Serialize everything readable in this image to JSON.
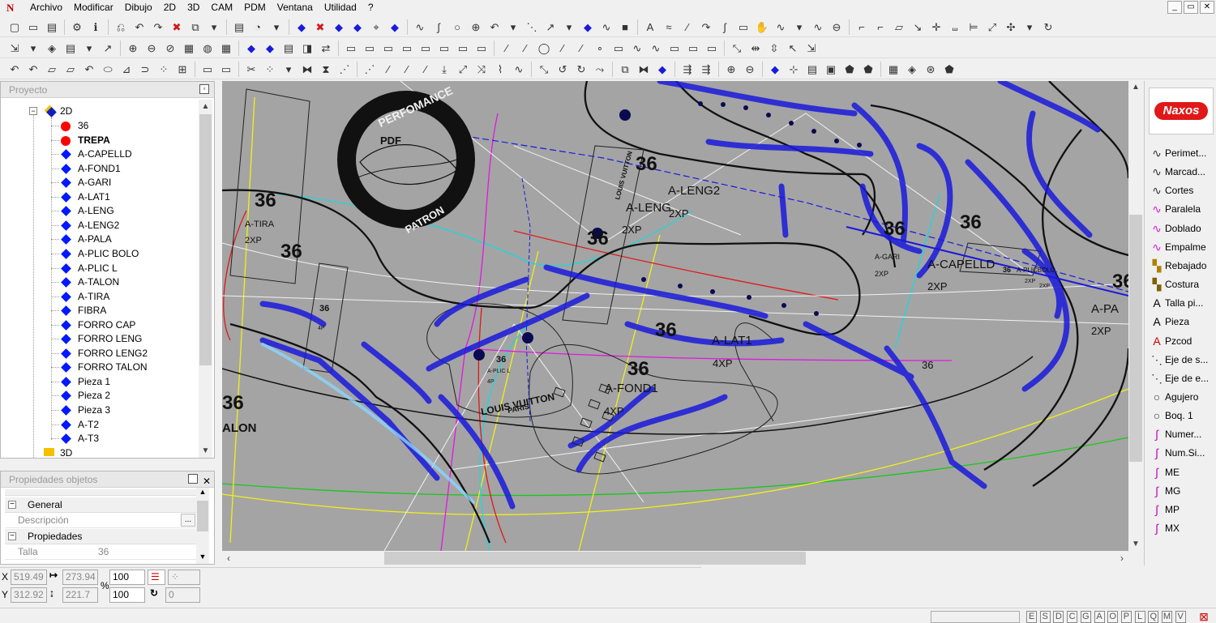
{
  "menu": {
    "items": [
      "Archivo",
      "Modificar",
      "Dibujo",
      "2D",
      "3D",
      "CAM",
      "PDM",
      "Ventana",
      "Utilidad",
      "?"
    ],
    "app_icon": "N"
  },
  "window_controls": [
    "_",
    "▭",
    "✕"
  ],
  "project_panel": {
    "title": "Proyecto",
    "root": "2D",
    "root_3d": "3D",
    "items": [
      {
        "label": "36",
        "icon": "red-circle",
        "bold": false
      },
      {
        "label": "TREPA",
        "icon": "red-circle",
        "bold": true
      },
      {
        "label": "A-CAPELLD",
        "icon": "blue-diamond",
        "bold": false
      },
      {
        "label": "A-FOND1",
        "icon": "blue-diamond",
        "bold": false
      },
      {
        "label": "A-GARI",
        "icon": "blue-diamond",
        "bold": false
      },
      {
        "label": "A-LAT1",
        "icon": "blue-diamond",
        "bold": false
      },
      {
        "label": "A-LENG",
        "icon": "blue-diamond",
        "bold": false
      },
      {
        "label": "A-LENG2",
        "icon": "blue-diamond",
        "bold": false
      },
      {
        "label": "A-PALA",
        "icon": "blue-diamond",
        "bold": false
      },
      {
        "label": "A-PLIC BOLO",
        "icon": "blue-diamond",
        "bold": false
      },
      {
        "label": "A-PLIC L",
        "icon": "blue-diamond",
        "bold": false
      },
      {
        "label": "A-TALON",
        "icon": "blue-diamond",
        "bold": false
      },
      {
        "label": "A-TIRA",
        "icon": "blue-diamond",
        "bold": false
      },
      {
        "label": "FIBRA",
        "icon": "blue-diamond",
        "bold": false
      },
      {
        "label": "FORRO CAP",
        "icon": "blue-diamond",
        "bold": false
      },
      {
        "label": "FORRO LENG",
        "icon": "blue-diamond",
        "bold": false
      },
      {
        "label": "FORRO LENG2",
        "icon": "blue-diamond",
        "bold": false
      },
      {
        "label": "FORRO TALON",
        "icon": "blue-diamond",
        "bold": false
      },
      {
        "label": "Pieza 1",
        "icon": "blue-diamond",
        "bold": false
      },
      {
        "label": "Pieza 2",
        "icon": "blue-diamond",
        "bold": false
      },
      {
        "label": "Pieza 3",
        "icon": "blue-diamond",
        "bold": false
      },
      {
        "label": "A-T2",
        "icon": "blue-diamond",
        "bold": false
      },
      {
        "label": "A-T3",
        "icon": "blue-diamond",
        "bold": false
      }
    ]
  },
  "properties_panel": {
    "title": "Propiedades objetos",
    "groups": [
      {
        "name": "General",
        "rows": [
          {
            "key": "Descripción",
            "value": ""
          }
        ]
      },
      {
        "name": "Propiedades",
        "rows": [
          {
            "key": "Talla",
            "value": "36"
          }
        ]
      }
    ]
  },
  "coordinates": {
    "x_label": "X",
    "y_label": "Y",
    "x": "519.49",
    "y": "312.92",
    "dx": "273.94",
    "dy": "221.7",
    "scale_x": "100",
    "scale_y": "100",
    "percent": "%",
    "angle": "0"
  },
  "right_tools": [
    {
      "label": "Perimet...",
      "icon": "curve-icon"
    },
    {
      "label": "Marcad...",
      "icon": "curve-icon"
    },
    {
      "label": "Cortes",
      "icon": "curve-icon"
    },
    {
      "label": "Paralela",
      "icon": "parallel-curve-icon"
    },
    {
      "label": "Doblado",
      "icon": "parallel-curve-icon"
    },
    {
      "label": "Empalme",
      "icon": "parallel-curve-icon"
    },
    {
      "label": "Rebajado",
      "icon": "rebajado-icon"
    },
    {
      "label": "Costura",
      "icon": "costura-icon"
    },
    {
      "label": "Talla pi...",
      "icon": "text-a-icon"
    },
    {
      "label": "Pieza",
      "icon": "text-a-icon"
    },
    {
      "label": "Pzcod",
      "icon": "text-a-red-icon"
    },
    {
      "label": "Eje de s...",
      "icon": "dotted-line-icon"
    },
    {
      "label": "Eje de e...",
      "icon": "dotted-line-icon"
    },
    {
      "label": "Agujero",
      "icon": "circle-icon"
    },
    {
      "label": "Boq. 1",
      "icon": "circle-icon"
    },
    {
      "label": "Numer...",
      "icon": "pen-curve-icon"
    },
    {
      "label": "Num.Si...",
      "icon": "pen-curve-icon"
    },
    {
      "label": "ME",
      "icon": "pen-curve-icon"
    },
    {
      "label": "MG",
      "icon": "pen-curve-icon"
    },
    {
      "label": "MP",
      "icon": "pen-curve-icon"
    },
    {
      "label": "MX",
      "icon": "pen-curve-icon"
    }
  ],
  "logo_text": "Naxos",
  "status_snaps": [
    "E",
    "S",
    "D",
    "C",
    "G",
    "A",
    "O",
    "P",
    "L",
    "Q",
    "M",
    "V"
  ],
  "canvas_labels": {
    "size_36": "36",
    "a_leng2": "A-LENG2",
    "a_leng": "A-LENG",
    "x2p": "2XP",
    "x4p": "4XP",
    "a_capelld": "A-CAPELLD",
    "a_gari": "A-GARI",
    "a_lat1": "A-LAT1",
    "a_fond1": "A-FOND1",
    "a_tira": "A-TIRA",
    "a_pa": "A-PA",
    "alon": "ALON",
    "a_t3": "A-T3",
    "a_plic_bolo": "A-PLICBOLO",
    "a_plic_l": "A-PLIC L",
    "lv_brand": "LOUIS VUITTON",
    "lv_city": "PARIS",
    "stamp_top": "PERFOMANCE",
    "stamp_mid": "PDF",
    "stamp_bottom": "PATRON",
    "lv_side": "LOUIS VUITTON",
    "x4p_small": "4P",
    "x4p_lower": "4P"
  },
  "colors": {
    "canvas_bg": "#a4a4a4",
    "piece_blue": "#1a1adc",
    "contour_black": "#111111",
    "line_red": "#e01818",
    "line_cyan": "#18d8e0",
    "line_yellow": "#f0f018",
    "line_green": "#18c818",
    "line_magenta": "#e018e0"
  }
}
